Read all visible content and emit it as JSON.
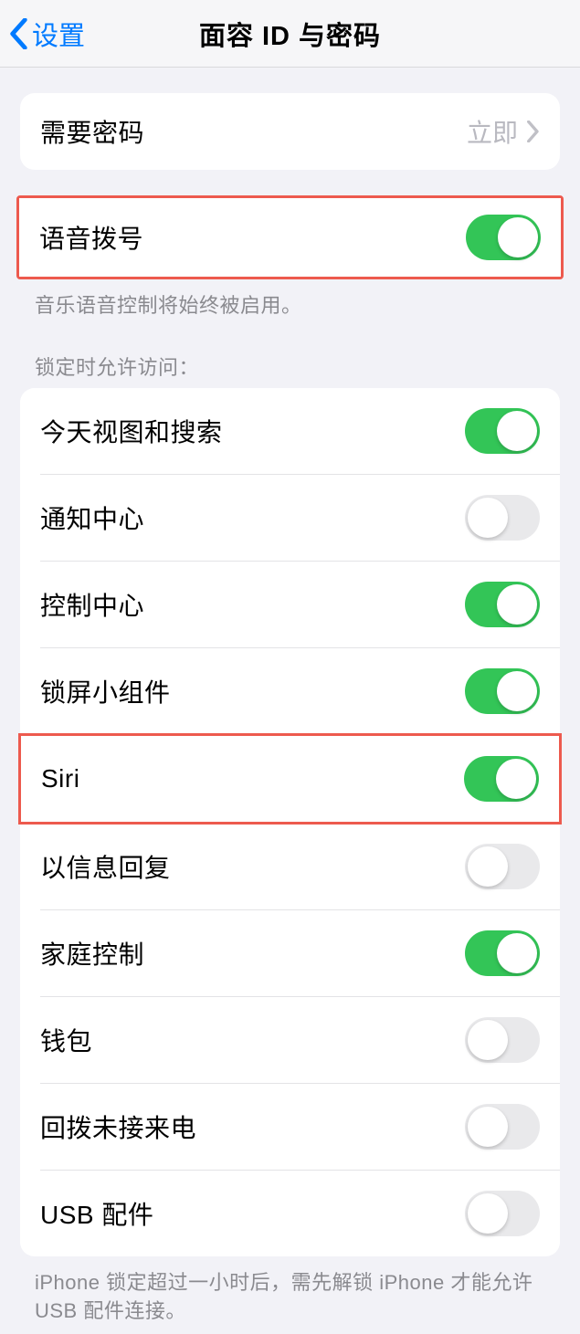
{
  "nav": {
    "back_label": "设置",
    "title": "面容 ID 与密码"
  },
  "require_passcode": {
    "label": "需要密码",
    "value": "立即"
  },
  "voice_dial": {
    "label": "语音拨号",
    "on": true,
    "footer": "音乐语音控制将始终被启用。"
  },
  "lock_header": "锁定时允许访问：",
  "lock_items": [
    {
      "label": "今天视图和搜索",
      "on": true,
      "highlight": false
    },
    {
      "label": "通知中心",
      "on": false,
      "highlight": false
    },
    {
      "label": "控制中心",
      "on": true,
      "highlight": false
    },
    {
      "label": "锁屏小组件",
      "on": true,
      "highlight": false
    },
    {
      "label": "Siri",
      "on": true,
      "highlight": true
    },
    {
      "label": "以信息回复",
      "on": false,
      "highlight": false
    },
    {
      "label": "家庭控制",
      "on": true,
      "highlight": false
    },
    {
      "label": "钱包",
      "on": false,
      "highlight": false
    },
    {
      "label": "回拨未接来电",
      "on": false,
      "highlight": false
    },
    {
      "label": "USB 配件",
      "on": false,
      "highlight": false
    }
  ],
  "usb_footer": "iPhone 锁定超过一小时后，需先解锁 iPhone 才能允许 USB 配件连接。"
}
